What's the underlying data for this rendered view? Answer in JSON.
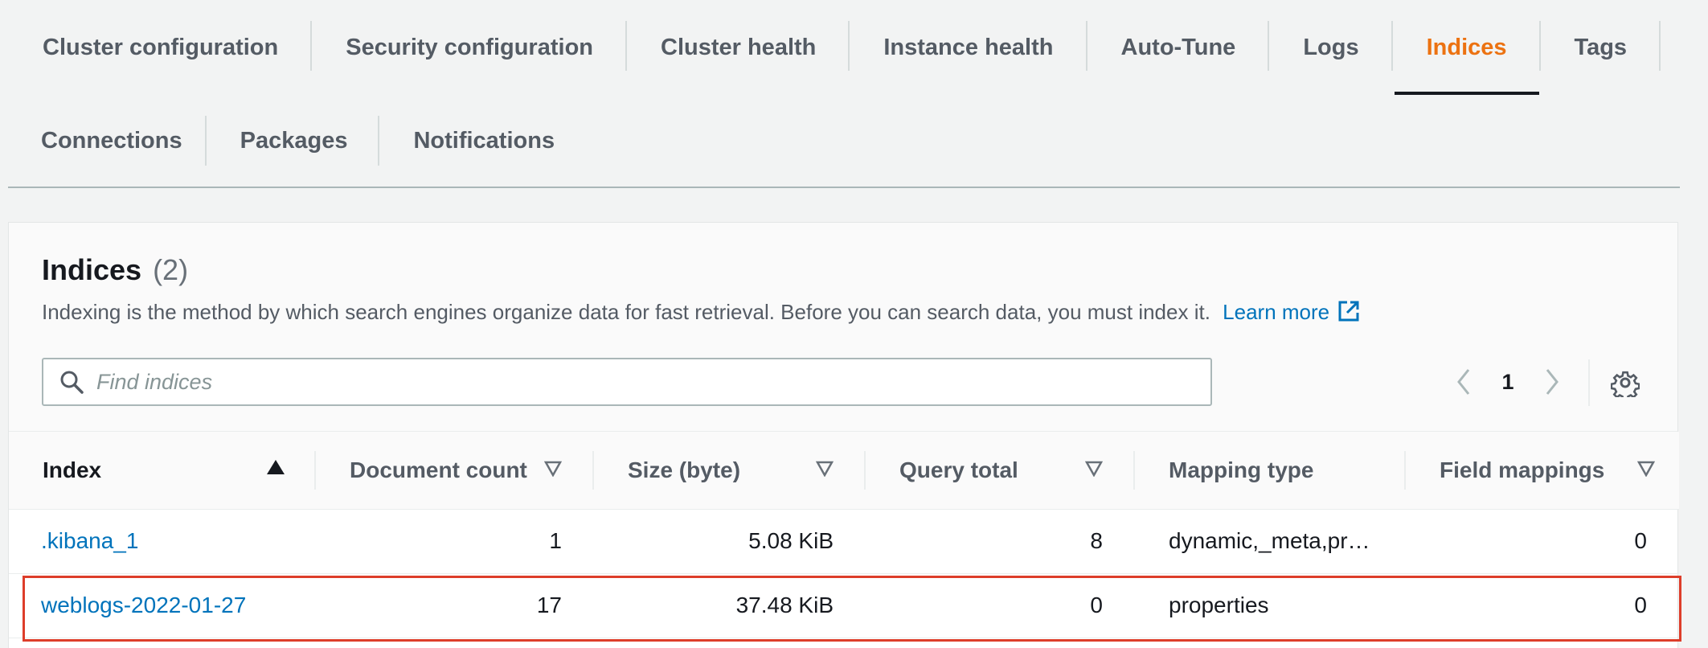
{
  "tabs": {
    "row1": [
      "Cluster configuration",
      "Security configuration",
      "Cluster health",
      "Instance health",
      "Auto-Tune",
      "Logs",
      "Indices",
      "Tags"
    ],
    "row2": [
      "Connections",
      "Packages",
      "Notifications"
    ],
    "active": "Indices"
  },
  "indices": {
    "title": "Indices",
    "count": "(2)",
    "description": "Indexing is the method by which search engines organize data for fast retrieval. Before you can search data, you must index it.",
    "learn_more": "Learn more",
    "search_placeholder": "Find indices",
    "page": "1"
  },
  "table": {
    "columns": [
      "Index",
      "Document count",
      "Size (byte)",
      "Query total",
      "Mapping type",
      "Field mappings"
    ],
    "rows": [
      {
        "index": ".kibana_1",
        "document_count": "1",
        "size": "5.08 KiB",
        "query_total": "8",
        "mapping_type": "dynamic,_meta,pr…",
        "field_mappings": "0"
      },
      {
        "index": "weblogs-2022-01-27",
        "document_count": "17",
        "size": "37.48 KiB",
        "query_total": "0",
        "mapping_type": "properties",
        "field_mappings": "0"
      }
    ]
  },
  "colors": {
    "active_tab": "#ec7211",
    "link": "#0073bb",
    "highlight": "#dd3d2a"
  }
}
